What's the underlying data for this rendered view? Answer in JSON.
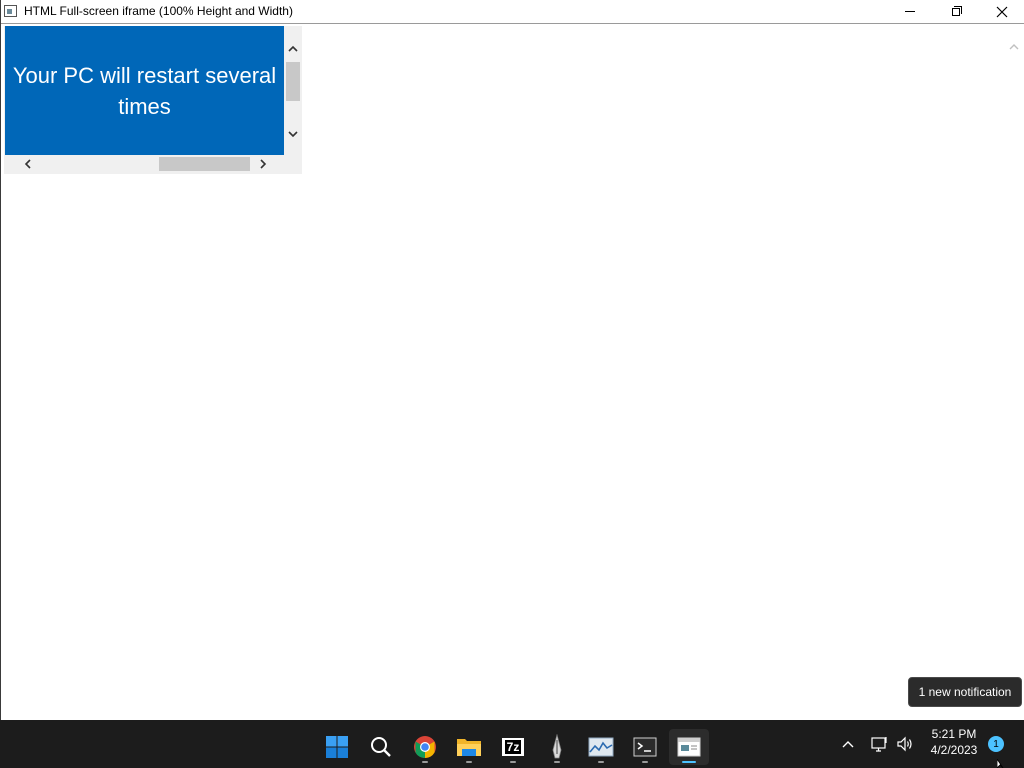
{
  "window": {
    "title": "HTML Full-screen iframe (100% Height and Width)"
  },
  "iframe": {
    "message": "Your PC will restart several times",
    "background_color": "#0067b8"
  },
  "taskbar": {
    "apps": [
      {
        "name": "Start",
        "icon": "windows-start-icon"
      },
      {
        "name": "Search",
        "icon": "search-icon"
      },
      {
        "name": "Google Chrome",
        "icon": "chrome-icon"
      },
      {
        "name": "File Explorer",
        "icon": "folder-icon"
      },
      {
        "name": "7-Zip",
        "icon": "7zip-icon",
        "label": "7z"
      },
      {
        "name": "Inkscape",
        "icon": "pen-nib-icon"
      },
      {
        "name": "Performance Monitor",
        "icon": "chart-icon"
      },
      {
        "name": "Terminal",
        "icon": "terminal-icon"
      },
      {
        "name": "HTML Viewer",
        "icon": "browser-window-icon",
        "active": true
      }
    ],
    "clock": {
      "time": "5:21 PM",
      "date": "4/2/2023"
    },
    "notification_count": "1"
  },
  "tooltip": {
    "text": "1 new notification"
  }
}
